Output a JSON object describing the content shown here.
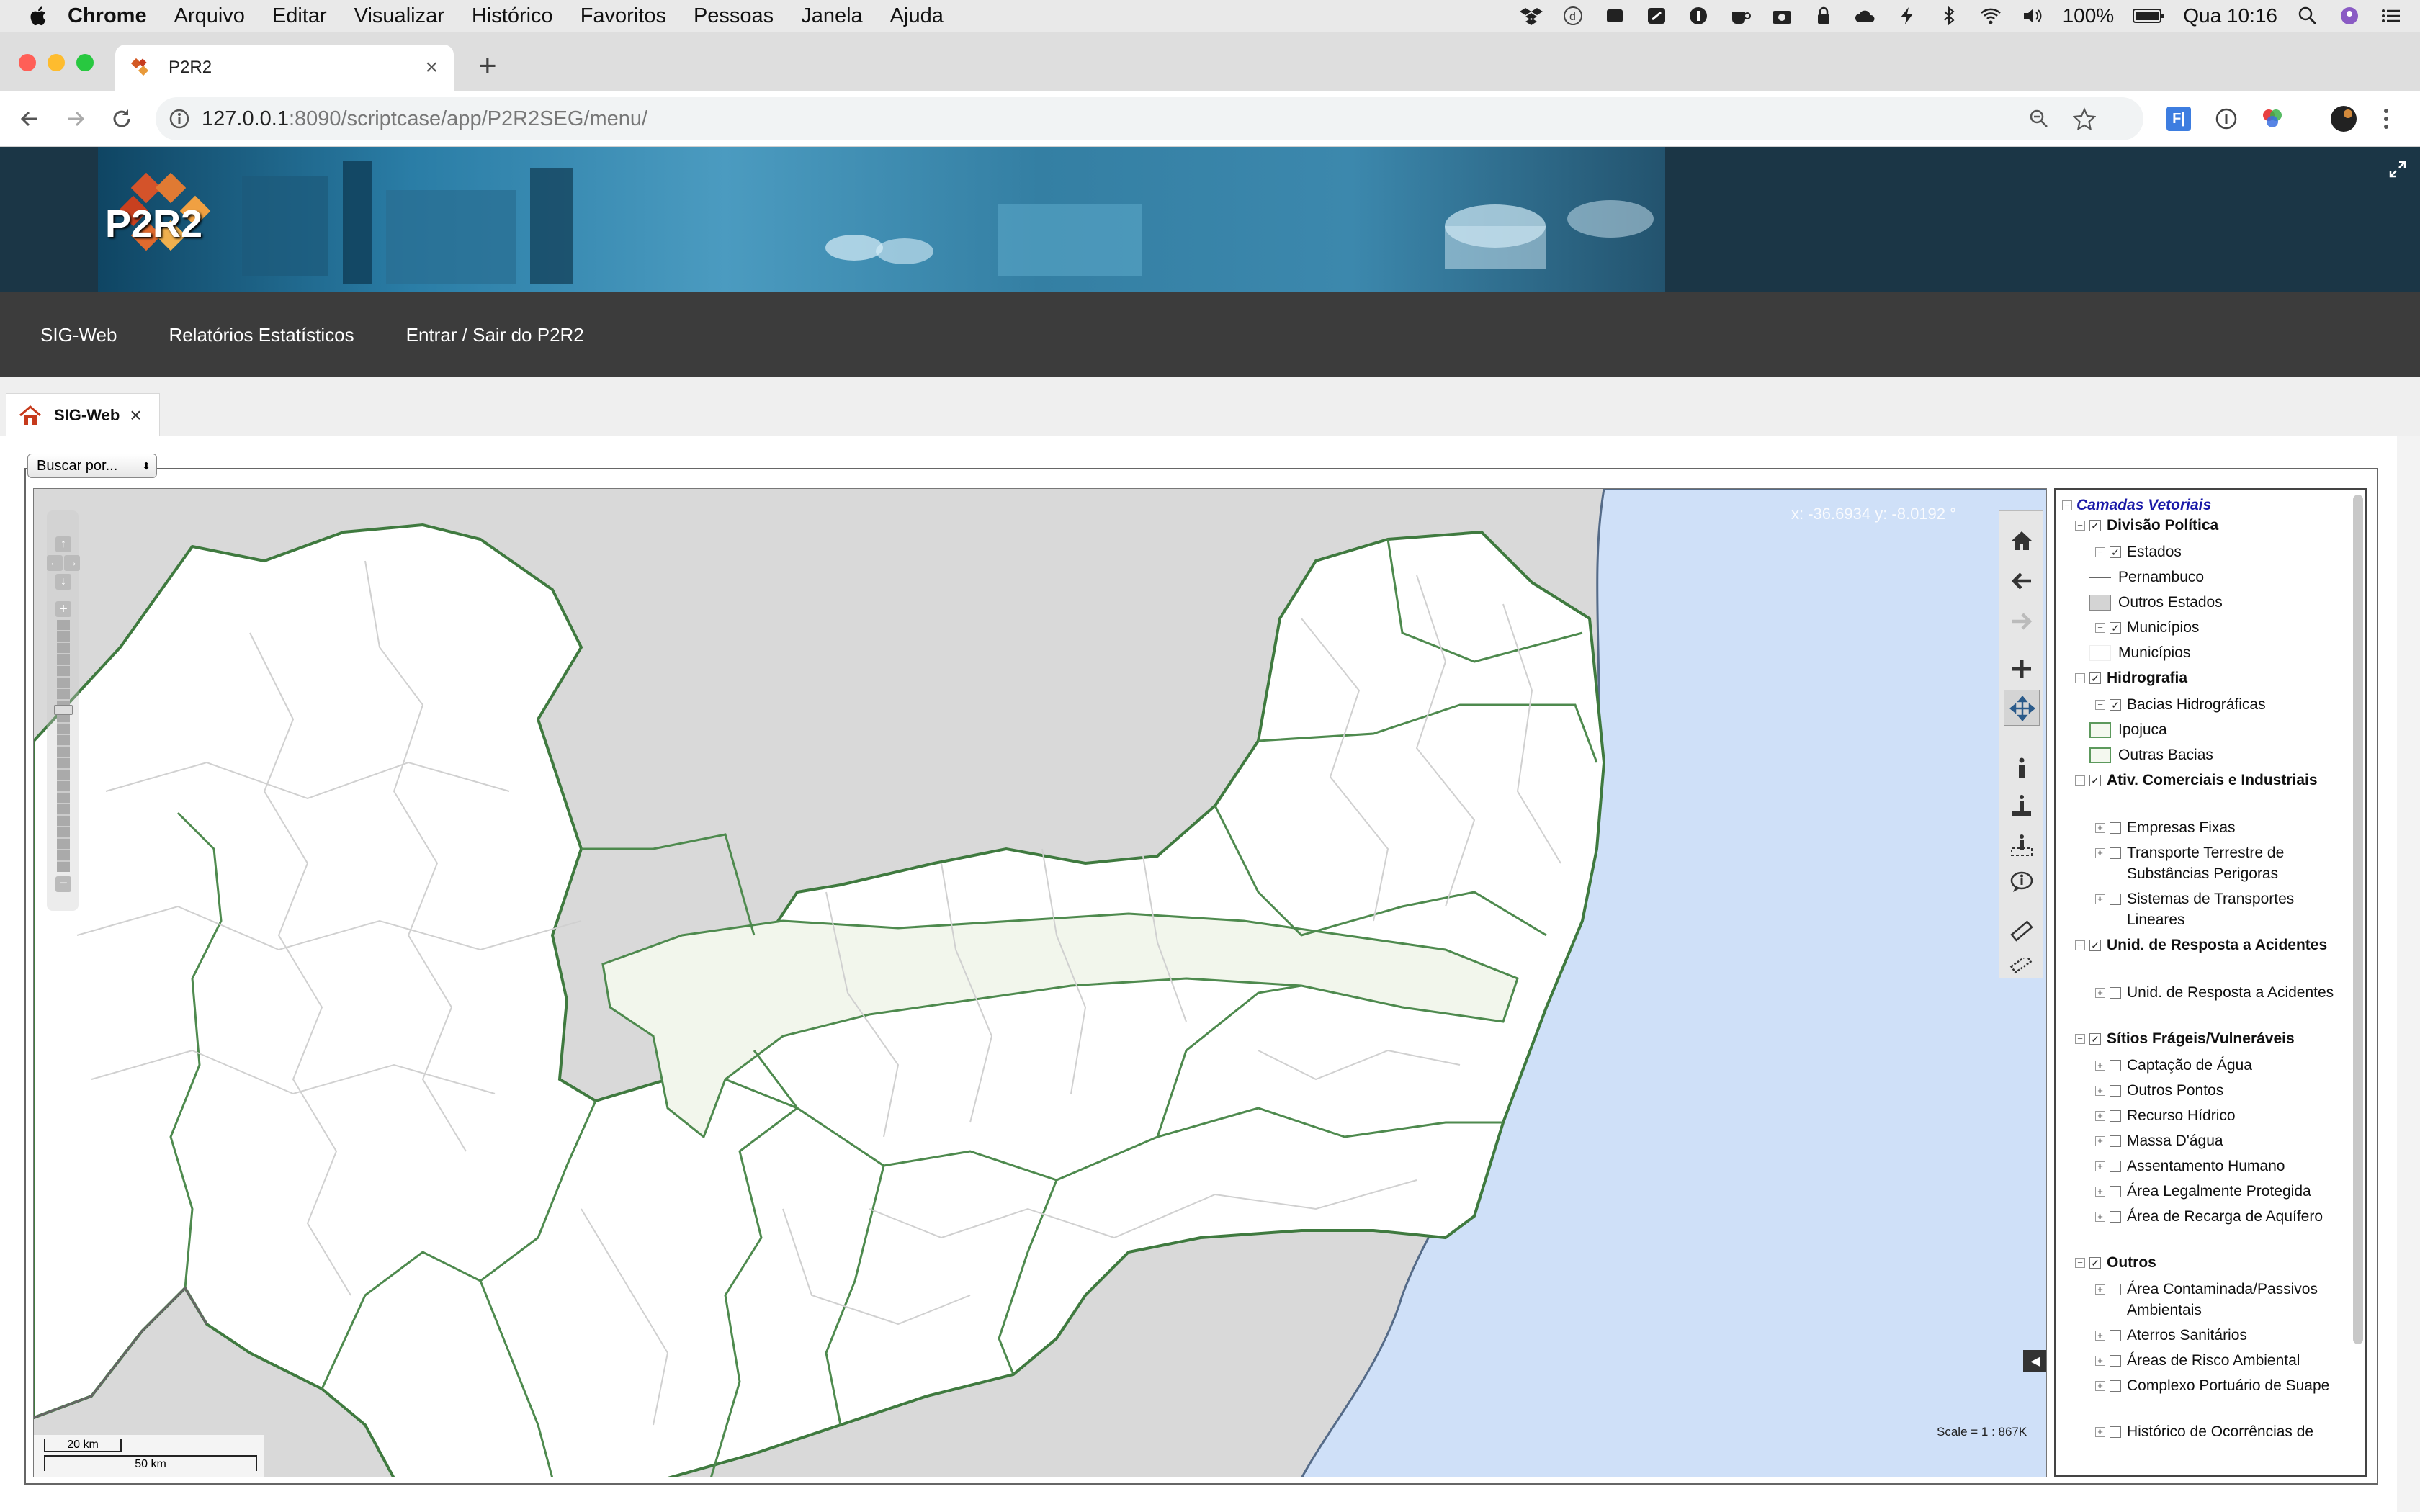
{
  "menubar": {
    "app_name": "Chrome",
    "items": [
      "Arquivo",
      "Editar",
      "Visualizar",
      "Histórico",
      "Favoritos",
      "Pessoas",
      "Janela",
      "Ajuda"
    ],
    "battery": "100%",
    "clock": "Qua 10:16"
  },
  "browser": {
    "tab_title": "P2R2",
    "url_host": "127.0.0.1",
    "url_rest": ":8090/scriptcase/app/P2R2SEG/menu/",
    "ext_label": "F|"
  },
  "header": {
    "logo_text": "P2R2",
    "nav": [
      "SIG-Web",
      "Relatórios Estatísticos",
      "Entrar / Sair do P2R2"
    ]
  },
  "app_tab": {
    "label": "SIG-Web",
    "close": "×"
  },
  "search": {
    "select_value": "Buscar por..."
  },
  "map": {
    "coords": "x: -36.6934  y: -8.0192 °",
    "scale_text": "Scale = 1 : 867K",
    "scalebar_top": "20 km",
    "scalebar_bottom": "50 km",
    "zoom_level_fraction": 0.65,
    "colors": {
      "sea": "#cfe0f8",
      "land": "#ffffff",
      "other_states": "#d9d9d9",
      "basin_border": "#4e8a4e",
      "ipojuca": "#f2f6ec"
    }
  },
  "legend": {
    "title": "Camadas Vetoriais",
    "rows": [
      {
        "label": "Divisão Política",
        "bold": true,
        "toggle": "−",
        "checked": true,
        "indent": 0
      },
      {
        "label": "Estados",
        "toggle": "−",
        "checked": true,
        "indent": 1
      },
      {
        "label": "Pernambuco",
        "swatch": "line",
        "indent": 2
      },
      {
        "label": "Outros Estados",
        "swatch": "gray",
        "indent": 2
      },
      {
        "label": "Municípios",
        "toggle": "−",
        "checked": true,
        "indent": 1
      },
      {
        "label": "Municípios",
        "swatch": "white",
        "indent": 2
      },
      {
        "label": "Hidrografia",
        "bold": true,
        "toggle": "−",
        "checked": true,
        "indent": 0
      },
      {
        "label": "Bacias Hidrográficas",
        "toggle": "−",
        "checked": true,
        "indent": 1
      },
      {
        "label": "Ipojuca",
        "swatch": "green",
        "indent": 2
      },
      {
        "label": "Outras Bacias",
        "swatch": "green",
        "indent": 2
      },
      {
        "label": "Ativ. Comerciais e Industriais",
        "bold": true,
        "toggle": "−",
        "checked": true,
        "indent": 0
      },
      {
        "label": "Empresas Fixas",
        "toggle": "+",
        "checked": false,
        "indent": 1
      },
      {
        "label": "Transporte Terrestre de Substâncias Perigoras",
        "toggle": "+",
        "checked": false,
        "indent": 1
      },
      {
        "label": "Sistemas de Transportes Lineares",
        "toggle": "+",
        "checked": false,
        "indent": 1
      },
      {
        "label": "Unid. de Resposta a Acidentes",
        "bold": true,
        "toggle": "−",
        "checked": true,
        "indent": 0
      },
      {
        "label": "Unid. de Resposta a Acidentes",
        "toggle": "+",
        "checked": false,
        "indent": 1
      },
      {
        "label": "Sítios Frágeis/Vulneráveis",
        "bold": true,
        "toggle": "−",
        "checked": true,
        "indent": 0
      },
      {
        "label": "Captação de Água",
        "toggle": "+",
        "checked": false,
        "indent": 1
      },
      {
        "label": "Outros Pontos",
        "toggle": "+",
        "checked": false,
        "indent": 1
      },
      {
        "label": "Recurso Hídrico",
        "toggle": "+",
        "checked": false,
        "indent": 1
      },
      {
        "label": "Massa D'água",
        "toggle": "+",
        "checked": false,
        "indent": 1
      },
      {
        "label": "Assentamento Humano",
        "toggle": "+",
        "checked": false,
        "indent": 1
      },
      {
        "label": "Área Legalmente Protegida",
        "toggle": "+",
        "checked": false,
        "indent": 1
      },
      {
        "label": "Área de Recarga de Aquífero",
        "toggle": "+",
        "checked": false,
        "indent": 1
      },
      {
        "label": "Outros",
        "bold": true,
        "toggle": "−",
        "checked": true,
        "indent": 0
      },
      {
        "label": "Área Contaminada/Passivos Ambientais",
        "toggle": "+",
        "checked": false,
        "indent": 1
      },
      {
        "label": "Aterros Sanitários",
        "toggle": "+",
        "checked": false,
        "indent": 1
      },
      {
        "label": "Áreas de Risco Ambiental",
        "toggle": "+",
        "checked": false,
        "indent": 1
      },
      {
        "label": "Complexo Portuário de Suape",
        "toggle": "+",
        "checked": false,
        "indent": 1
      },
      {
        "label": "Histórico de Ocorrências de",
        "toggle": "+",
        "checked": false,
        "indent": 1
      }
    ]
  }
}
